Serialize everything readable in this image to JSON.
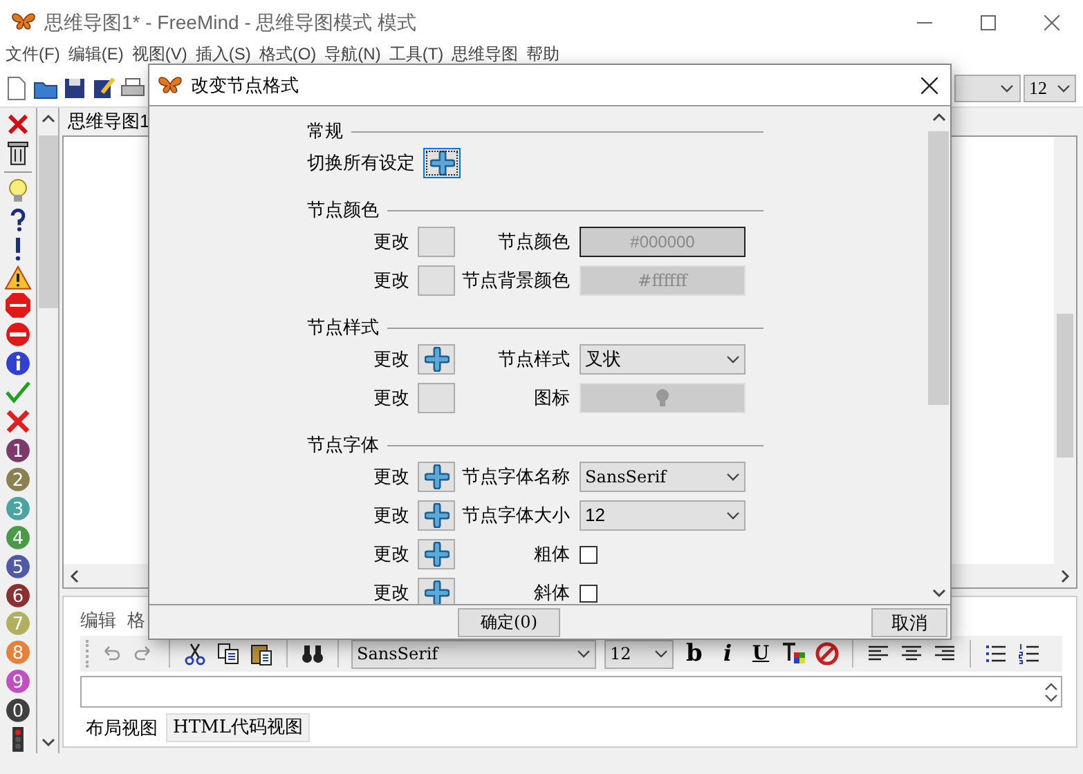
{
  "window": {
    "title": "思维导图1* - FreeMind - 思维导图模式 模式"
  },
  "menu": [
    "文件(F)",
    "编辑(E)",
    "视图(V)",
    "插入(S)",
    "格式(O)",
    "导航(N)",
    "工具(T)",
    "思维导图",
    "帮助"
  ],
  "toolbar": {
    "buttons": [
      {
        "kind": "new"
      },
      {
        "kind": "open"
      },
      {
        "kind": "save"
      },
      {
        "kind": "edit"
      },
      {
        "kind": "print"
      }
    ],
    "font_size": "12"
  },
  "icon_palette": [
    {
      "kind": "remove"
    },
    {
      "kind": "trash"
    },
    {
      "kind": "bulb"
    },
    {
      "kind": "question"
    },
    {
      "kind": "exclamation"
    },
    {
      "kind": "warning"
    },
    {
      "kind": "stop"
    },
    {
      "kind": "no-entry"
    },
    {
      "kind": "info"
    },
    {
      "kind": "check"
    },
    {
      "kind": "cross"
    },
    {
      "kind": "number",
      "label": "1",
      "color": "#7a3b6a"
    },
    {
      "kind": "number",
      "label": "2",
      "color": "#8a8050"
    },
    {
      "kind": "number",
      "label": "3",
      "color": "#4aa5a0"
    },
    {
      "kind": "number",
      "label": "4",
      "color": "#4a9a48"
    },
    {
      "kind": "number",
      "label": "5",
      "color": "#5058a8"
    },
    {
      "kind": "number",
      "label": "6",
      "color": "#8a3030"
    },
    {
      "kind": "number",
      "label": "7",
      "color": "#b0b060"
    },
    {
      "kind": "number",
      "label": "8",
      "color": "#e8803a"
    },
    {
      "kind": "number",
      "label": "9",
      "color": "#c050c0"
    },
    {
      "kind": "number",
      "label": "0",
      "color": "#404040"
    },
    {
      "kind": "traffic-light"
    }
  ],
  "map_tab": {
    "label": "思维导图1"
  },
  "note_editor": {
    "tabs": [
      "编辑",
      "格"
    ],
    "toolbar": {
      "font": "SansSerif",
      "size": "12",
      "buttons": [
        {
          "kind": "undo"
        },
        {
          "kind": "redo"
        },
        {
          "kind": "cut"
        },
        {
          "kind": "copy"
        },
        {
          "kind": "paste"
        },
        {
          "kind": "find"
        },
        {
          "kind": "font"
        },
        {
          "kind": "bold",
          "label": "b"
        },
        {
          "kind": "italic",
          "label": "i"
        },
        {
          "kind": "underline",
          "label": "U"
        },
        {
          "kind": "text-color"
        },
        {
          "kind": "clear-format"
        },
        {
          "kind": "align-left"
        },
        {
          "kind": "align-center"
        },
        {
          "kind": "align-right"
        },
        {
          "kind": "bullets"
        },
        {
          "kind": "numbering"
        }
      ]
    },
    "view_tabs": [
      {
        "label": "布局视图",
        "selected": true
      },
      {
        "label": "HTML代码视图",
        "selected": false
      }
    ]
  },
  "dialog": {
    "title": "改变节点格式",
    "sections": [
      {
        "title": "常规",
        "rows": [
          {
            "kind": "toggle",
            "label": "切换所有设定",
            "set": true,
            "focused": true
          }
        ]
      },
      {
        "title": "节点颜色",
        "rows": [
          {
            "kind": "color",
            "change": "更改",
            "set": false,
            "label": "节点颜色",
            "value": "#000000",
            "focused": true,
            "disabled": true
          },
          {
            "kind": "color",
            "change": "更改",
            "set": false,
            "label": "节点背景颜色",
            "value": "#ffffff",
            "focused": false,
            "disabled": true
          }
        ]
      },
      {
        "title": "节点样式",
        "rows": [
          {
            "kind": "select",
            "change": "更改",
            "set": true,
            "label": "节点样式",
            "value": "叉状"
          },
          {
            "kind": "icon",
            "change": "更改",
            "set": false,
            "label": "图标"
          }
        ]
      },
      {
        "title": "节点字体",
        "rows": [
          {
            "kind": "select",
            "change": "更改",
            "set": true,
            "label": "节点字体名称",
            "value": "SansSerif"
          },
          {
            "kind": "select",
            "change": "更改",
            "set": true,
            "label": "节点字体大小",
            "value": "12"
          },
          {
            "kind": "checkbox",
            "change": "更改",
            "set": true,
            "label": "粗体",
            "checked": false
          },
          {
            "kind": "checkbox",
            "change": "更改",
            "set": true,
            "label": "斜体",
            "checked": false
          }
        ]
      }
    ],
    "buttons": [
      "确定(0)",
      "取消"
    ]
  }
}
